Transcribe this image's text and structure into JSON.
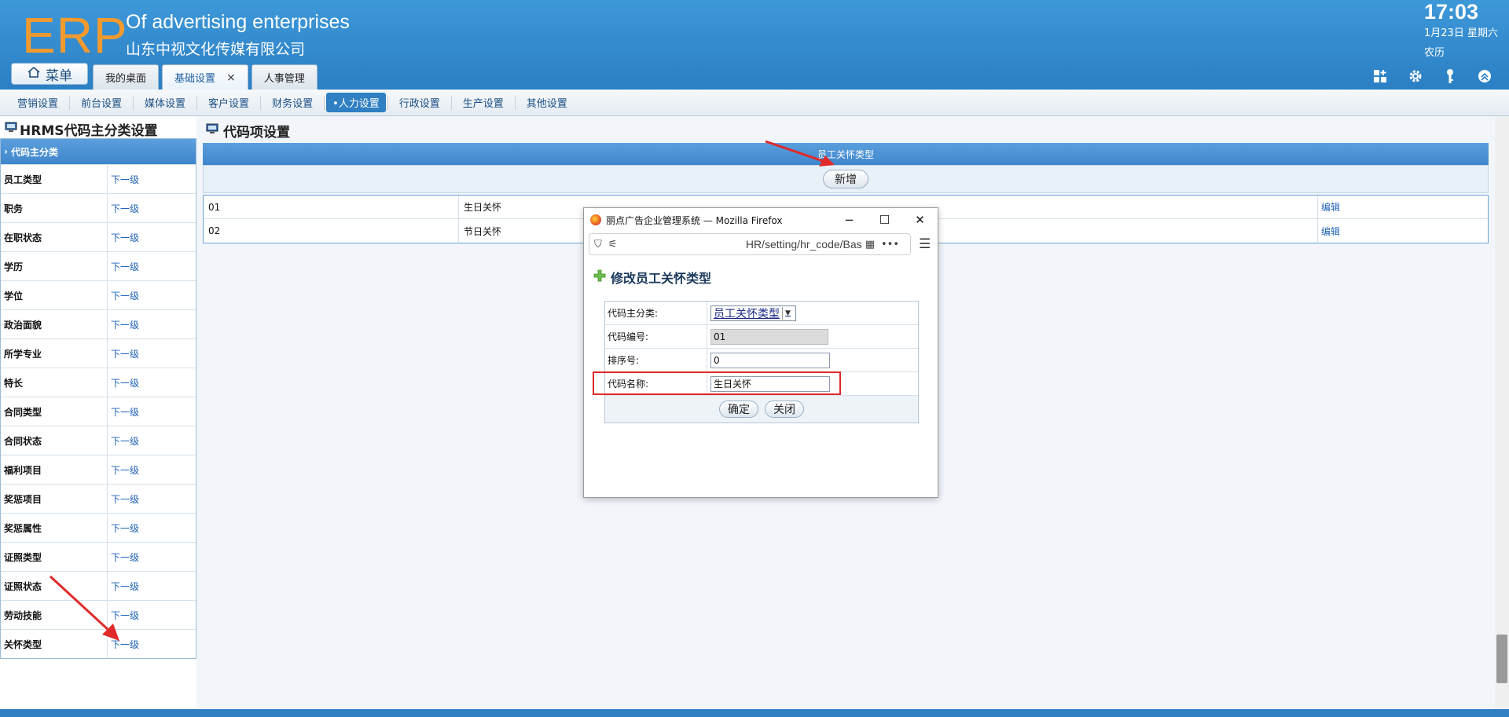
{
  "header": {
    "logo": "ERP",
    "company_en": "Of advertising enterprises",
    "company_cn": "山东中视文化传媒有限公司",
    "clock": "17:03",
    "date": "1月23日 星期六",
    "lunar": "农历",
    "menu_label": "菜单",
    "tabs": [
      {
        "label": "我的桌面"
      },
      {
        "label": "基础设置",
        "close": "×"
      },
      {
        "label": "人事管理"
      }
    ],
    "icons": [
      "grid-add-icon",
      "gear-icon",
      "key-icon",
      "chevron-up-icon"
    ]
  },
  "subnav": {
    "items": [
      "营销设置",
      "前台设置",
      "媒体设置",
      "客户设置",
      "财务设置",
      "•人力设置",
      "行政设置",
      "生产设置",
      "其他设置"
    ]
  },
  "left": {
    "title": "HRMS代码主分类设置",
    "head": "代码主分类",
    "rows": [
      {
        "name": "员工类型",
        "link": "下一级"
      },
      {
        "name": "职务",
        "link": "下一级"
      },
      {
        "name": "在职状态",
        "link": "下一级"
      },
      {
        "name": "学历",
        "link": "下一级"
      },
      {
        "name": "学位",
        "link": "下一级"
      },
      {
        "name": "政治面貌",
        "link": "下一级"
      },
      {
        "name": "所学专业",
        "link": "下一级"
      },
      {
        "name": "特长",
        "link": "下一级"
      },
      {
        "name": "合同类型",
        "link": "下一级"
      },
      {
        "name": "合同状态",
        "link": "下一级"
      },
      {
        "name": "福利项目",
        "link": "下一级"
      },
      {
        "name": "奖惩项目",
        "link": "下一级"
      },
      {
        "name": "奖惩属性",
        "link": "下一级"
      },
      {
        "name": "证照类型",
        "link": "下一级"
      },
      {
        "name": "证照状态",
        "link": "下一级"
      },
      {
        "name": "劳动技能",
        "link": "下一级"
      },
      {
        "name": "关怀类型",
        "link": "下一级"
      }
    ]
  },
  "main": {
    "title": "代码项设置",
    "head": "员工关怀类型",
    "add_button": "新增",
    "rows": [
      {
        "code": "01",
        "name": "生日关怀",
        "action": "编辑"
      },
      {
        "code": "02",
        "name": "节日关怀",
        "action": "编辑"
      }
    ]
  },
  "popup": {
    "window_title": "丽点广告企业管理系统 — Mozilla Firefox",
    "url": "HR/setting/hr_code/Bas",
    "minimize": "−",
    "maximize": "☐",
    "close": "✕",
    "menu": "☰",
    "title": "修改员工关怀类型",
    "fields": {
      "category_label": "代码主分类:",
      "category_value": "员工关怀类型",
      "code_label": "代码编号:",
      "code_value": "01",
      "order_label": "排序号:",
      "order_value": "0",
      "name_label": "代码名称:",
      "name_value": "生日关怀"
    },
    "confirm": "确定",
    "close_button": "关闭"
  },
  "colors": {
    "header_blue": "#2b7fc4",
    "logo_orange": "#f39a2e",
    "link_blue": "#1f63b8",
    "highlight_red": "#e02a2a"
  }
}
